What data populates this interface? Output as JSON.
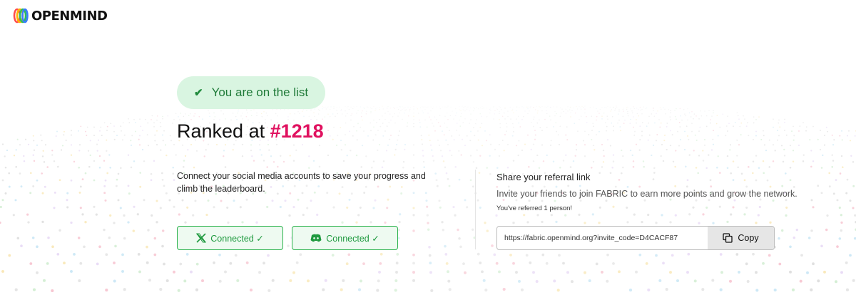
{
  "brand": {
    "name": "OPENMIND"
  },
  "status": {
    "icon": "check-icon",
    "text": "You are on the list"
  },
  "rank": {
    "prefix": "Ranked at ",
    "value": "#1218"
  },
  "connect": {
    "description": "Connect your social media accounts to save your progress and climb the leaderboard.",
    "buttons": [
      {
        "icon": "x-logo-icon",
        "label": "Connected ✓"
      },
      {
        "icon": "discord-icon",
        "label": "Connected ✓"
      }
    ]
  },
  "referral": {
    "title": "Share your referral link",
    "description": "Invite your friends to join FABRIC to earn more points and grow the network.",
    "count_text": "You've referred 1 person!",
    "link_value": "https://fabric.openmind.org?invite_code=D4CACF87",
    "copy_label": "Copy",
    "copy_icon": "copy-icon"
  },
  "colors": {
    "accent_pink": "#e0115f",
    "success_green": "#1f8a3c",
    "pill_bg": "#d9f5e1",
    "button_border": "#2bb24c"
  }
}
